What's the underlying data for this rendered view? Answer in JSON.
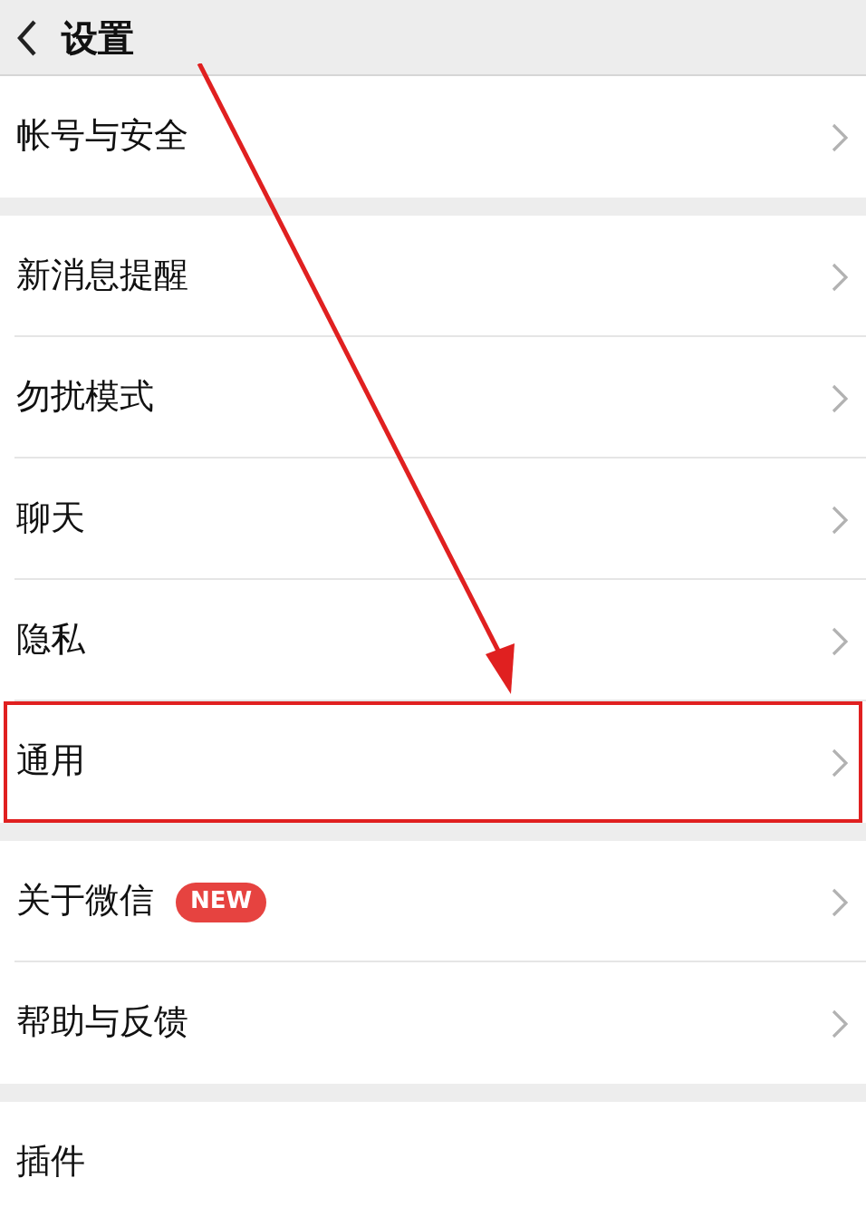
{
  "header": {
    "title": "设置"
  },
  "groups": [
    {
      "items": [
        {
          "label": "帐号与安全",
          "highlighted": false
        }
      ]
    },
    {
      "items": [
        {
          "label": "新消息提醒",
          "highlighted": false
        },
        {
          "label": "勿扰模式",
          "highlighted": false
        },
        {
          "label": "聊天",
          "highlighted": false
        },
        {
          "label": "隐私",
          "highlighted": false
        },
        {
          "label": "通用",
          "highlighted": true
        }
      ]
    },
    {
      "items": [
        {
          "label": "关于微信",
          "badge": "NEW",
          "highlighted": false
        },
        {
          "label": "帮助与反馈",
          "highlighted": false
        }
      ]
    },
    {
      "items": [
        {
          "label": "插件",
          "highlighted": false,
          "chevron": false
        }
      ]
    }
  ]
}
